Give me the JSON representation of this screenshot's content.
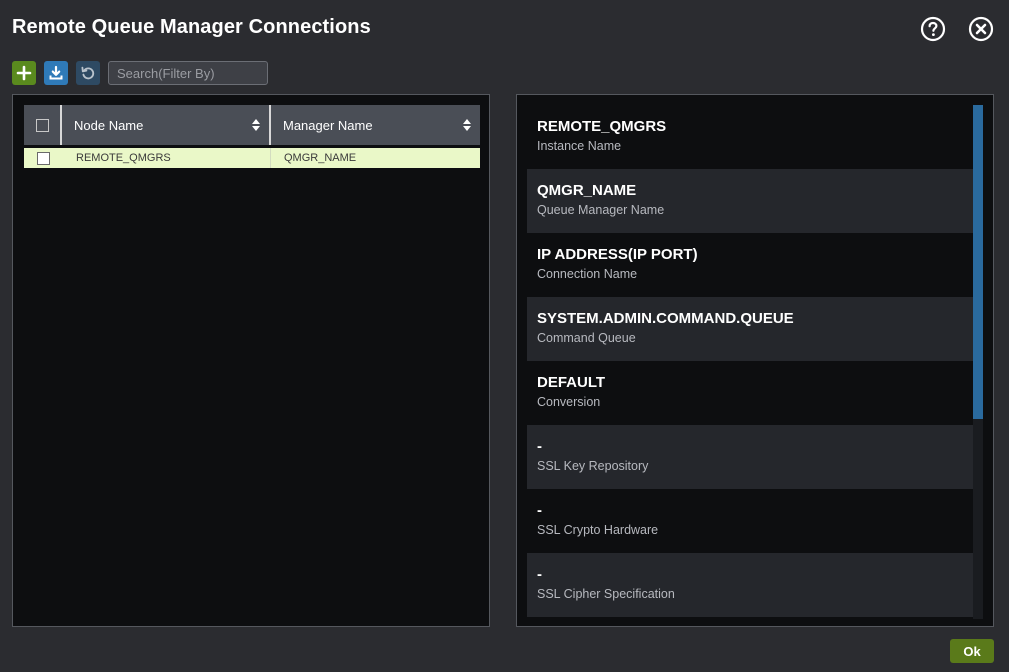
{
  "window": {
    "title": "Remote Queue Manager Connections"
  },
  "header": {
    "help_icon": "question-circle-icon",
    "close_icon": "close-circle-icon"
  },
  "toolbar": {
    "add_icon": "plus-icon",
    "download_icon": "download-icon",
    "refresh_icon": "refresh-icon",
    "search_placeholder": "Search(Filter By)",
    "search_value": ""
  },
  "grid": {
    "columns": [
      "Node Name",
      "Manager Name"
    ],
    "rows": [
      {
        "node_name": "REMOTE_QMGRS",
        "manager_name": "QMGR_NAME",
        "selected": false
      }
    ]
  },
  "details": [
    {
      "value": "REMOTE_QMGRS",
      "label": "Instance Name"
    },
    {
      "value": "QMGR_NAME",
      "label": "Queue Manager Name"
    },
    {
      "value": "IP ADDRESS(IP PORT)",
      "label": "Connection Name"
    },
    {
      "value": "SYSTEM.ADMIN.COMMAND.QUEUE",
      "label": "Command Queue"
    },
    {
      "value": "DEFAULT",
      "label": "Conversion"
    },
    {
      "value": "-",
      "label": "SSL Key Repository"
    },
    {
      "value": "-",
      "label": "SSL Crypto Hardware"
    },
    {
      "value": "-",
      "label": "SSL Cipher Specification"
    }
  ],
  "footer": {
    "ok_label": "Ok"
  },
  "colors": {
    "add_button": "#5a8a1e",
    "download_button": "#2f7ab8",
    "selected_row": "#eaf8c8",
    "ok_button": "#5a7a1a",
    "scroll_thumb": "#2a6a9e"
  }
}
